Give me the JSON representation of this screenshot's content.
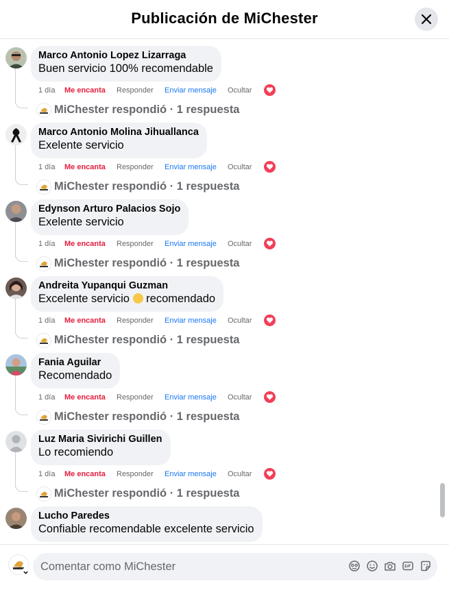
{
  "header": {
    "title": "Publicación de MiChester"
  },
  "comments": [
    {
      "author": "Marco Antonio Lopez Lizarraga",
      "text": "Buen servicio 100% recomendable",
      "time": "1 día",
      "love": "Me encanta",
      "reply": "Responder",
      "message": "Enviar mensaje",
      "hide": "Ocultar",
      "reply_summary": "MiChester respondió · 1 respuesta",
      "avatar_color": "#7a8a6a"
    },
    {
      "author": "Marco Antonio Molina Jihuallanca",
      "text": "Exelente servicio",
      "time": "1 día",
      "love": "Me encanta",
      "reply": "Responder",
      "message": "Enviar mensaje",
      "hide": "Ocultar",
      "reply_summary": "MiChester respondió · 1 respuesta",
      "avatar_color": "#e9e9e9"
    },
    {
      "author": "Edynson Arturo Palacios Sojo",
      "text": "Exelente servicio",
      "time": "1 día",
      "love": "Me encanta",
      "reply": "Responder",
      "message": "Enviar mensaje",
      "hide": "Ocultar",
      "reply_summary": "MiChester respondió · 1 respuesta",
      "avatar_color": "#6d6e72"
    },
    {
      "author": "Andreita Yupanqui Guzman",
      "text_before": "Excelente servicio ",
      "text_after": " recomendado",
      "time": "1 día",
      "love": "Me encanta",
      "reply": "Responder",
      "message": "Enviar mensaje",
      "hide": "Ocultar",
      "reply_summary": "MiChester respondió · 1 respuesta",
      "avatar_color": "#5a4a48"
    },
    {
      "author": "Fania Aguilar",
      "text": "Recomendado",
      "time": "1 día",
      "love": "Me encanta",
      "reply": "Responder",
      "message": "Enviar mensaje",
      "hide": "Ocultar",
      "reply_summary": "MiChester respondió · 1 respuesta",
      "avatar_color": "#8aa6c2"
    },
    {
      "author": "Luz Maria Sivirichi Guillen",
      "text": "Lo recomiendo",
      "time": "1 día",
      "love": "Me encanta",
      "reply": "Responder",
      "message": "Enviar mensaje",
      "hide": "Ocultar",
      "reply_summary": "MiChester respondió · 1 respuesta",
      "avatar_color": "#c9ccd1"
    },
    {
      "author": "Lucho Paredes",
      "text": "Confiable recomendable excelente servicio",
      "avatar_color": "#8c7766"
    }
  ],
  "composer": {
    "placeholder": "Comentar como MiChester"
  },
  "colors": {
    "accent": "#1877f2",
    "love": "#e41e3f",
    "bubble": "#f0f2f5"
  }
}
